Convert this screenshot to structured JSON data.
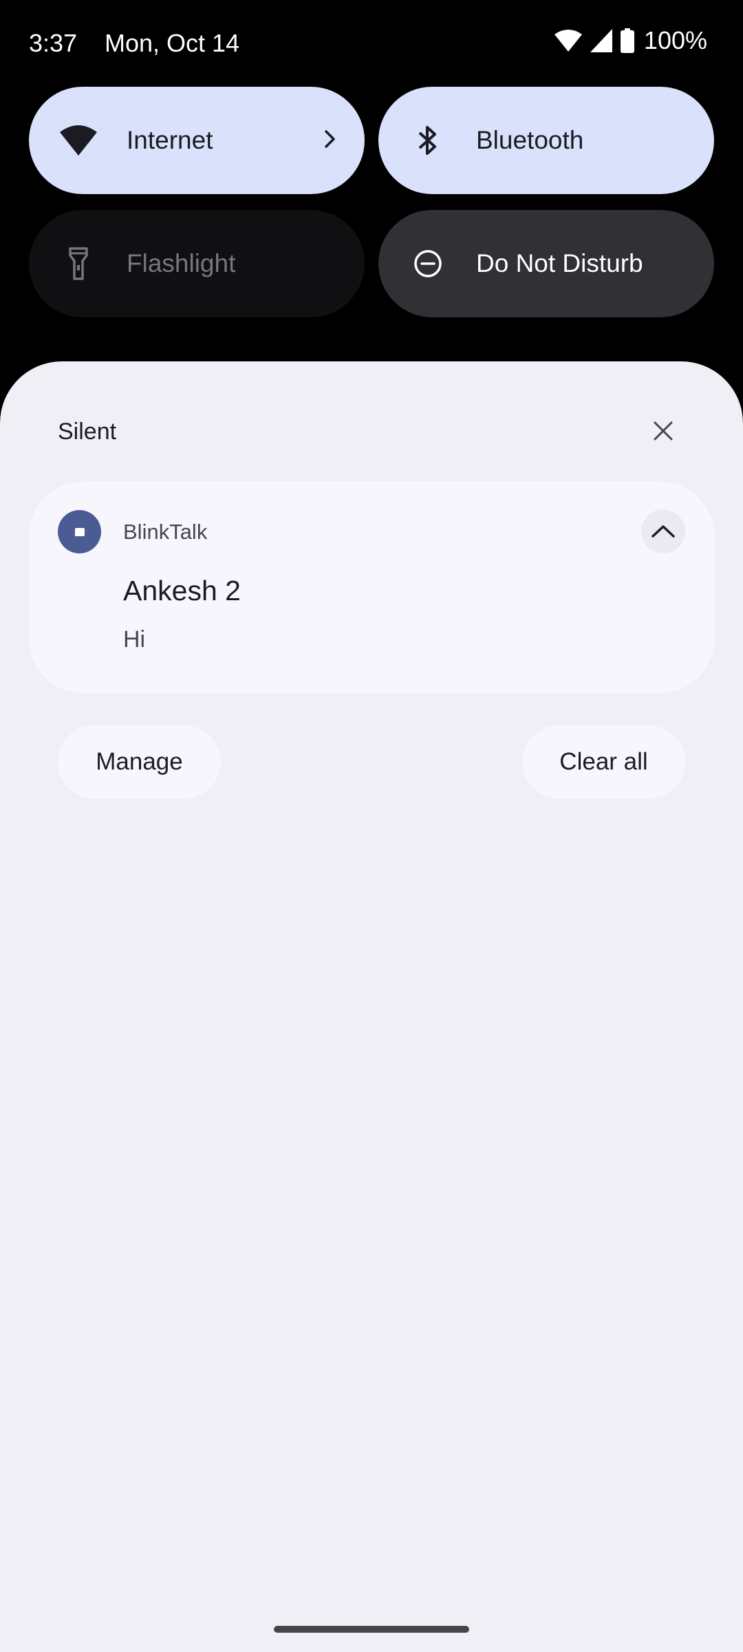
{
  "status_bar": {
    "time": "3:37",
    "date": "Mon, Oct 14",
    "battery_text": "100%"
  },
  "quick_settings": {
    "tiles": [
      {
        "label": "Internet",
        "icon": "wifi-icon",
        "state": "on"
      },
      {
        "label": "Bluetooth",
        "icon": "bluetooth-icon",
        "state": "on"
      },
      {
        "label": "Flashlight",
        "icon": "flashlight-icon",
        "state": "off"
      },
      {
        "label": "Do Not Disturb",
        "icon": "do-not-disturb-icon",
        "state": "off"
      }
    ]
  },
  "notifications": {
    "section_title": "Silent",
    "items": [
      {
        "app_name": "BlinkTalk",
        "title": "Ankesh 2",
        "text": "Hi"
      }
    ],
    "manage_label": "Manage",
    "clear_all_label": "Clear all"
  },
  "colors": {
    "tile_on": "#d9e1fb",
    "shade_background": "#f0eff6",
    "app_icon": "#4b5b93"
  }
}
